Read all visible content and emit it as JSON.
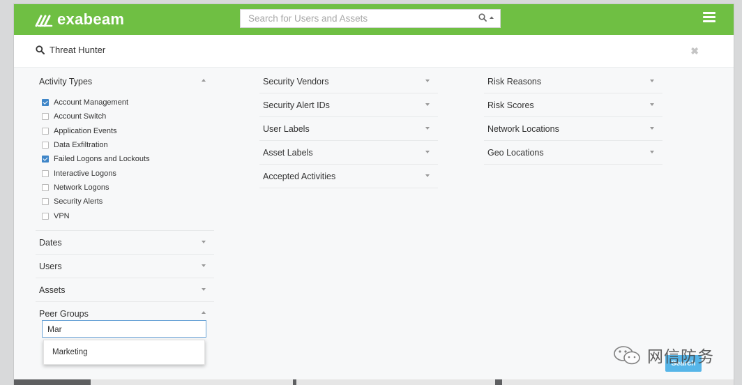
{
  "app": {
    "brand": "exabeam"
  },
  "search": {
    "placeholder": "Search for Users and Assets"
  },
  "panel": {
    "title": "Threat Hunter"
  },
  "column1": {
    "activity_types": {
      "label": "Activity Types",
      "items": [
        {
          "label": "Account Management",
          "checked": true
        },
        {
          "label": "Account Switch",
          "checked": false
        },
        {
          "label": "Application Events",
          "checked": false
        },
        {
          "label": "Data Exfiltration",
          "checked": false
        },
        {
          "label": "Failed Logons and Lockouts",
          "checked": true
        },
        {
          "label": "Interactive Logons",
          "checked": false
        },
        {
          "label": "Network Logons",
          "checked": false
        },
        {
          "label": "Security Alerts",
          "checked": false
        },
        {
          "label": "VPN",
          "checked": false
        }
      ]
    },
    "sections": [
      "Dates",
      "Users",
      "Assets"
    ],
    "peer_groups": {
      "label": "Peer Groups",
      "input_value": "Mar",
      "suggestions": [
        "Marketing"
      ]
    }
  },
  "column2": {
    "sections": [
      "Security Vendors",
      "Security Alert IDs",
      "User Labels",
      "Asset Labels",
      "Accepted Activities"
    ]
  },
  "column3": {
    "sections": [
      "Risk Reasons",
      "Risk Scores",
      "Network Locations",
      "Geo Locations"
    ]
  },
  "actions": {
    "search_label": "Search"
  },
  "watermark": {
    "text": "网信防务"
  },
  "colors": {
    "topbar": "#6fbf43",
    "checkbox_checked": "#3f86c8",
    "search_button": "#56b5e8",
    "input_focus": "#6aa3d6"
  },
  "icons": [
    "exabeam-logo-icon",
    "search-icon",
    "caret-up-icon",
    "hamburger-menu-icon",
    "close-icon",
    "caret-down-icon",
    "wechat-icon"
  ]
}
